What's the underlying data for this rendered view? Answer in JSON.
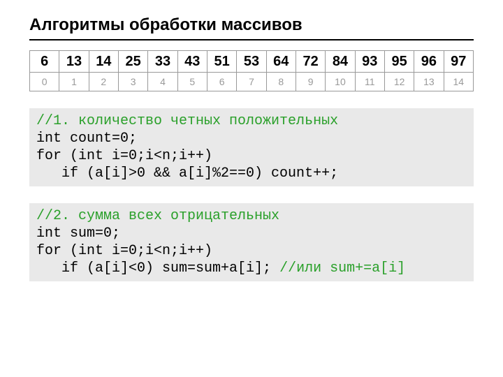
{
  "title": "Алгоритмы обработки массивов",
  "array": {
    "values": [
      "6",
      "13",
      "14",
      "25",
      "33",
      "43",
      "51",
      "53",
      "64",
      "72",
      "84",
      "93",
      "95",
      "96",
      "97"
    ],
    "indices": [
      "0",
      "1",
      "2",
      "3",
      "4",
      "5",
      "6",
      "7",
      "8",
      "9",
      "10",
      "11",
      "12",
      "13",
      "14"
    ]
  },
  "code1": {
    "comment": "//1. количество четных положительных",
    "l1": "int count=0;",
    "l2": "for (int i=0;i<n;i++)",
    "l3": "   if (a[i]>0 && a[i]%2==0) count++;"
  },
  "code2": {
    "comment": "//2. сумма всех отрицательных",
    "l1": "int sum=0;",
    "l2": "for (int i=0;i<n;i++)",
    "l3a": "   if (a[i]<0) sum=sum+a[i]; ",
    "l3b": "//или sum+=a[i]"
  }
}
